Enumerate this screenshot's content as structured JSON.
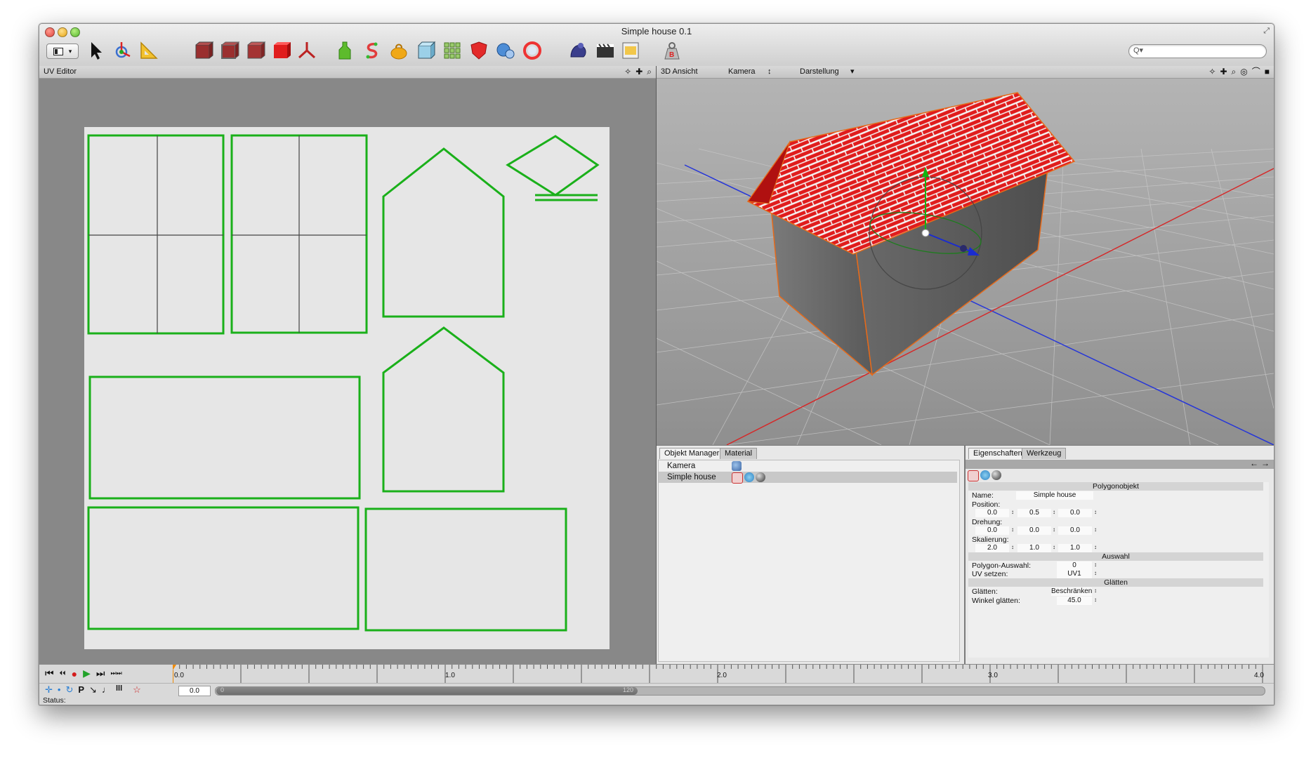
{
  "window": {
    "title": "Simple house 0.1"
  },
  "toolbar": {
    "layout_label": "",
    "search_placeholder": "Q▾",
    "icons": [
      "layout-icon",
      "pointer-icon",
      "move-tool-icon",
      "ruler-icon",
      "cube-select-icon",
      "cube-edge-icon",
      "cube-face-icon",
      "red-cube-icon",
      "axis-icon",
      "bottle-icon",
      "spline-icon",
      "bag-icon",
      "box-icon",
      "grid-icon",
      "shield-icon",
      "array-icon",
      "ring-icon",
      "paint-icon",
      "render-settings-icon",
      "save-icon",
      "weight-icon"
    ]
  },
  "uv_editor": {
    "title": "UV Editor",
    "icons": [
      "✧",
      "✚",
      "⌕"
    ]
  },
  "view3d": {
    "title": "3D Ansicht",
    "camera": "Kamera",
    "camera_arrow": "↕",
    "display": "Darstellung",
    "display_arrow": "▾",
    "icons": [
      "✧",
      "✚",
      "⌕",
      "◎",
      "⌒",
      "■"
    ]
  },
  "object_manager": {
    "tabs": [
      "Objekt Manager",
      "Material"
    ],
    "rows": [
      {
        "name": "Kamera",
        "selected": false
      },
      {
        "name": "Simple house",
        "selected": true
      }
    ]
  },
  "properties": {
    "tabs": [
      "Eigenschaften",
      "Werkzeug"
    ],
    "nav": [
      "←",
      "→"
    ],
    "section_main": "Polygonobjekt",
    "name_label": "Name:",
    "name_value": "Simple house",
    "position_label": "Position:",
    "position": [
      "0.0",
      "0.5",
      "0.0"
    ],
    "rotation_label": "Drehung:",
    "rotation": [
      "0.0",
      "0.0",
      "0.0"
    ],
    "scale_label": "Skalierung:",
    "scale": [
      "2.0",
      "1.0",
      "1.0"
    ],
    "section_selection": "Auswahl",
    "poly_sel_label": "Polygon-Auswahl:",
    "poly_sel_value": "0",
    "uv_label": "UV setzen:",
    "uv_value": "UV1",
    "section_smooth": "Glätten",
    "smooth_label": "Glätten:",
    "smooth_value": "Beschränken",
    "angle_label": "Winkel glätten:",
    "angle_value": "45.0",
    "spinner": "↕"
  },
  "timeline": {
    "controls": [
      "⏮",
      "⏴⏴",
      "●",
      "▶",
      "⏭",
      "⏭⏭"
    ],
    "ruler_labels": [
      "0.0",
      "1.0",
      "2.0",
      "3.0",
      "4.0"
    ],
    "tools": [
      "✛",
      "•",
      "↻",
      "P",
      "↘",
      "♩",
      "lll",
      "☆"
    ],
    "frame_value": "0.0",
    "scrub_start": "0",
    "scrub_end": "120",
    "status": "Status:"
  },
  "colors": {
    "uv_lines": "#1ab01a",
    "roof": "#e21b1b",
    "accent_orange": "#f08a00"
  }
}
